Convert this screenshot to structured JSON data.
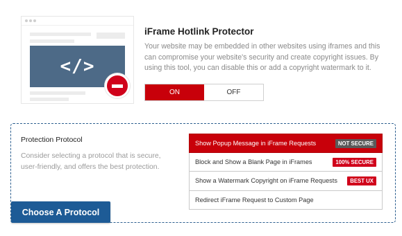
{
  "header": {
    "title": "iFrame Hotlink Protector",
    "description": "Your website may be embedded in other websites using iframes and this can compromise your website's security and create copyright issues. By using this tool, you can disable this or add a copyright watermark to it."
  },
  "illustration": {
    "code_symbol": "</>",
    "icon": "stop-icon"
  },
  "toggle": {
    "on_label": "ON",
    "off_label": "OFF",
    "selected": "ON"
  },
  "protocol": {
    "title": "Protection Protocol",
    "description": "Consider selecting a protocol that is secure, user-friendly, and offers the best protection.",
    "options": [
      {
        "label": "Show Popup Message in iFrame Requests",
        "badge": "NOT SECURE",
        "selected": true
      },
      {
        "label": "Block and Show a Blank Page in iFrames",
        "badge": "100% SECURE",
        "selected": false
      },
      {
        "label": "Show a Watermark Copyright on iFrame Requests",
        "badge": "BEST UX",
        "selected": false
      },
      {
        "label": "Redirect iFrame Request to Custom Page",
        "badge": "",
        "selected": false
      }
    ],
    "choose_button": "Choose A Protocol"
  },
  "colors": {
    "accent_red": "#c8000a",
    "primary_blue": "#1d5b96",
    "screen_blue": "#4d6a87",
    "badge_dark": "#5a5a5a"
  }
}
